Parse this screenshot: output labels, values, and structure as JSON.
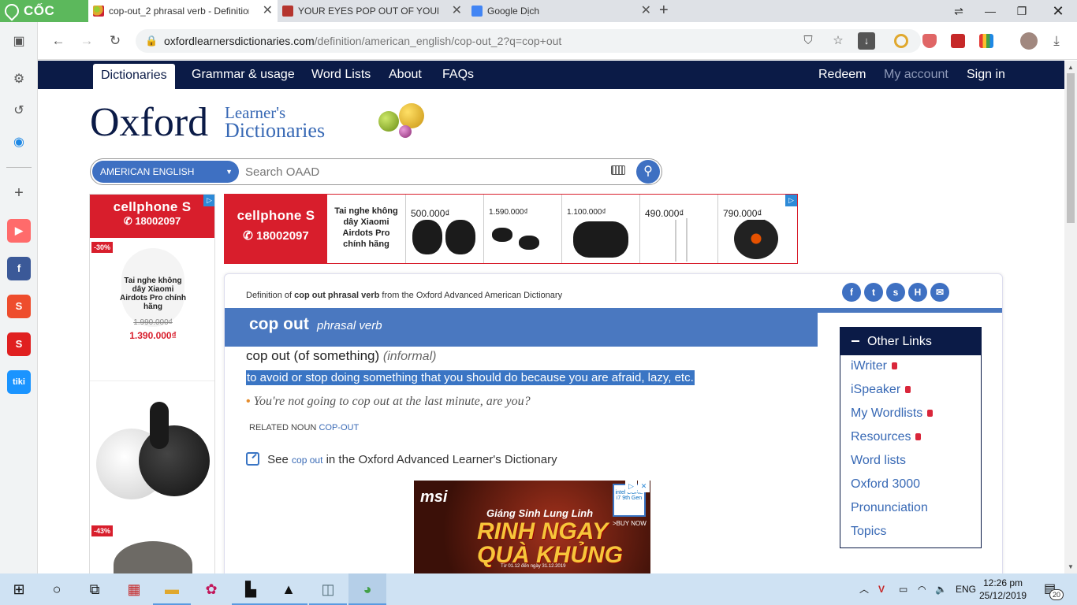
{
  "browser": {
    "brand": "CỐC CỐC",
    "tabs": [
      {
        "title": "cop-out_2 phrasal verb - Definition",
        "active": true
      },
      {
        "title": "YOUR EYES POP OUT OF YOUR HE",
        "active": false
      },
      {
        "title": "Google Dịch",
        "active": false
      }
    ],
    "url_host": "oxfordlearnersdictionaries.com",
    "url_path": "/definition/american_english/cop-out_2?q=cop+out"
  },
  "sidebar": {
    "icons": [
      "screen-icon",
      "settings-icon",
      "history-icon",
      "messenger-icon",
      "add-icon",
      "youtube-icon",
      "facebook-icon",
      "shopee-icon",
      "sendo-icon",
      "tiki-icon"
    ],
    "tiki_label": "tiki"
  },
  "site_nav": {
    "left": [
      "Dictionaries",
      "Grammar & usage",
      "Word Lists",
      "About",
      "FAQs"
    ],
    "right": [
      "Redeem",
      "My account",
      "Sign in"
    ]
  },
  "logo": {
    "main": "Oxford",
    "line1": "Learner's",
    "line2": "Dictionaries"
  },
  "search": {
    "dictionary": "AMERICAN ENGLISH",
    "placeholder": "Search OAAD"
  },
  "ad_left": {
    "brand": "cellphone S",
    "phone": "18002097",
    "discount1": "-30%",
    "product": "Tai nghe không dây Xiaomi Airdots Pro chính hãng",
    "old_price": "1.990.000₫",
    "new_price": "1.390.000₫",
    "discount2": "-43%"
  },
  "ad_banner": {
    "brand": "cellphone S",
    "phone": "18002097",
    "product": "Tai nghe không dây Xiaomi Airdots Pro chính hãng",
    "prices": [
      "500.000₫",
      "1.590.000₫",
      "1.100.000₫",
      "490.000₫",
      "790.000₫"
    ]
  },
  "entry": {
    "source_prefix": "Definition of",
    "source_term": "cop out phrasal verb",
    "source_suffix": "from the Oxford Advanced American Dictionary",
    "headword": "cop out",
    "pos": "phrasal verb",
    "sense": "cop out (of something)",
    "register": "(informal)",
    "definition": "to avoid or stop doing something that you should do because you are afraid, lazy, etc.",
    "example": "You're not going to cop out at the last minute, are you?",
    "related_label": "RELATED NOUN",
    "related_link": "COP-OUT",
    "see_prefix": "See",
    "see_term": "cop out",
    "see_suffix": "in the Oxford Advanced Learner's Dictionary"
  },
  "share_icons": [
    "facebook-icon",
    "twitter-icon",
    "stumbleupon-icon",
    "hatena-icon",
    "email-icon"
  ],
  "other_links": {
    "title": "Other Links",
    "items": [
      {
        "label": "iWriter",
        "locked": true
      },
      {
        "label": "iSpeaker",
        "locked": true
      },
      {
        "label": "My Wordlists",
        "locked": true
      },
      {
        "label": "Resources",
        "locked": true
      },
      {
        "label": "Word lists",
        "locked": false
      },
      {
        "label": "Oxford 3000",
        "locked": false
      },
      {
        "label": "Pronunciation",
        "locked": false
      },
      {
        "label": "Topics",
        "locked": false
      }
    ]
  },
  "ad_msi": {
    "brand": "msi",
    "line1": "Giáng Sinh Lung Linh",
    "line2": "RINH NGAY",
    "line3": "QUÀ KHỦNG",
    "cta": ">BUY NOW",
    "chip": "intel CORE i7 9th Gen",
    "fine": "Từ 01.12 đến ngày 31.12.2019"
  },
  "taskbar": {
    "lang": "ENG",
    "time": "12:26 pm",
    "date": "25/12/2019",
    "notifications": "20"
  },
  "colors": {
    "navy": "#0b1b47",
    "oxford_blue": "#4a78c0",
    "link_blue": "#3869b5",
    "highlight": "#3a75c4",
    "cellphones_red": "#d81e2c"
  }
}
